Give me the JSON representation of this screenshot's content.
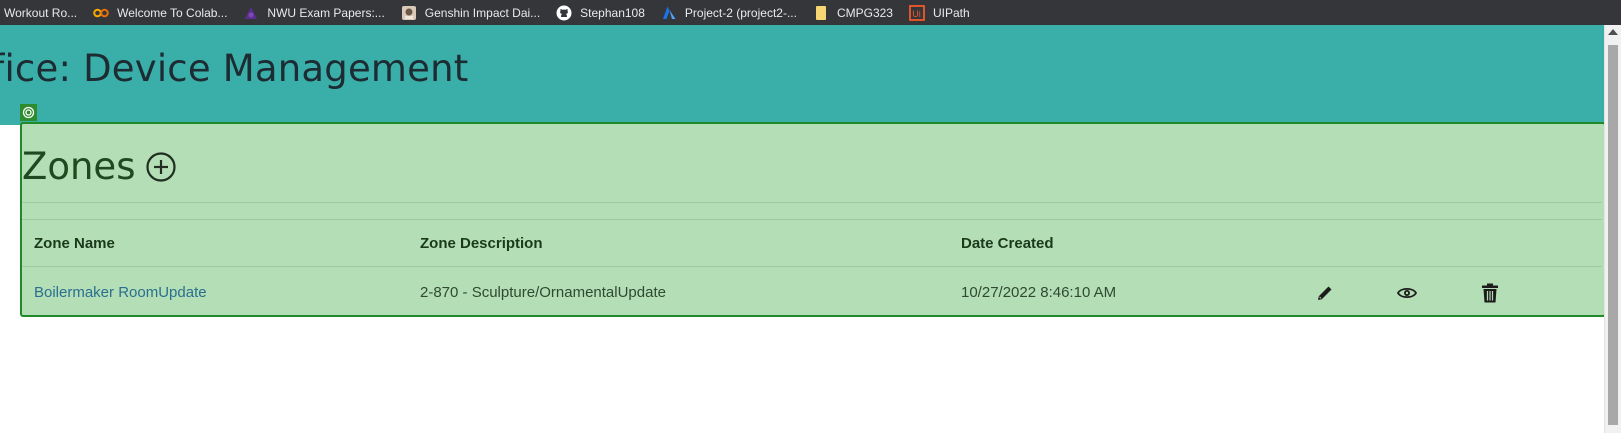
{
  "bookmarks": [
    {
      "label": "Workout Ro...",
      "icon": "none"
    },
    {
      "label": "Welcome To Colab...",
      "icon": "colab-icon"
    },
    {
      "label": "NWU Exam Papers:...",
      "icon": "nwu-icon"
    },
    {
      "label": "Genshin Impact Dai...",
      "icon": "genshin-icon"
    },
    {
      "label": "Stephan108",
      "icon": "github-icon"
    },
    {
      "label": "Project-2 (project2-...",
      "icon": "azure-icon"
    },
    {
      "label": "CMPG323",
      "icon": "folder-icon"
    },
    {
      "label": "UIPath",
      "icon": "uipath-icon"
    }
  ],
  "header": {
    "title": "ffice: Device Management",
    "background": "#3aafa9"
  },
  "zones": {
    "title": "Zones",
    "add_icon": "plus-circle-icon",
    "overlay_color": "#b4deb6",
    "columns": [
      "Zone Name",
      "Zone Description",
      "Date Created"
    ],
    "rows": [
      {
        "name": "Boilermaker RoomUpdate",
        "description": "2-870 - Sculpture/OrnamentalUpdate",
        "date_created": "10/27/2022 8:46:10 AM",
        "actions": [
          "pencil-icon",
          "eye-icon",
          "trash-icon"
        ]
      }
    ]
  }
}
